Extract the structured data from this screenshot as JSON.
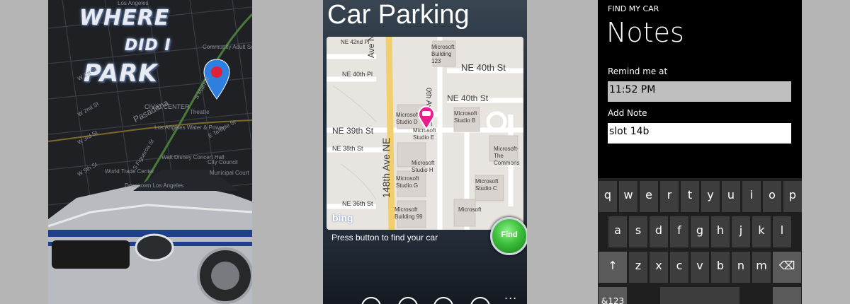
{
  "splash": {
    "logo": {
      "line1": "WHERE",
      "line2": "DID I",
      "line3": "PARK"
    },
    "map_labels": [
      "Los Angeles",
      "Pasadena",
      "CIVIC CENTER",
      "Downtown Los Angeles",
      "Los Angeles Water & Power",
      "Walt Disney Concert Hall",
      "World Trade Center",
      "Community Adult School",
      "City Council",
      "Municipal Court",
      "S Figueroa St",
      "W 1st St",
      "W 2nd St",
      "W 3rd St",
      "E Temple St",
      "S Main St",
      "W 5th St",
      "Theatre"
    ],
    "accent_color": "#e0203a"
  },
  "parking": {
    "title": "Car Parking",
    "streets": {
      "ne42": "NE 42nd Pl",
      "ne40_a": "NE 40th Pl",
      "ne40_b": "NE 40th St",
      "ne40_c": "NE 40th St",
      "ne39": "NE 39th St",
      "ne38": "NE 38th St",
      "ne36": "NE 36th St",
      "ave148_top": "Ave NE",
      "ave148_main": "148th Ave NE",
      "ave_right": "0th Ave NE"
    },
    "buildings": [
      "Microsoft Building 123",
      "Microsoft Studio D",
      "Microsoft Studio E",
      "Microsoft Studio B",
      "Microsoft Studio H",
      "Microsoft Studio G",
      "Microsoft-The Commons",
      "Microsoft Studio C",
      "Microsoft Building 99",
      "Microsoft"
    ],
    "map_brand": "bing",
    "hint": "Press button to find your car",
    "find_label": "Find",
    "appbar_more": "..."
  },
  "notes": {
    "app_name": "FIND MY CAR",
    "title": "Notes",
    "remind_label": "Remind me at",
    "remind_value": "11:52 PM",
    "note_label": "Add Note",
    "note_value": "slot 14b",
    "keyboard": {
      "row1": [
        "q",
        "w",
        "e",
        "r",
        "t",
        "y",
        "u",
        "i",
        "o",
        "p"
      ],
      "row2": [
        "a",
        "s",
        "d",
        "f",
        "g",
        "h",
        "j",
        "k",
        "l"
      ],
      "row3": [
        "z",
        "x",
        "c",
        "v",
        "b",
        "n",
        "m"
      ],
      "shift": "↑",
      "backspace": "⌫",
      "numbers": "&123"
    }
  }
}
